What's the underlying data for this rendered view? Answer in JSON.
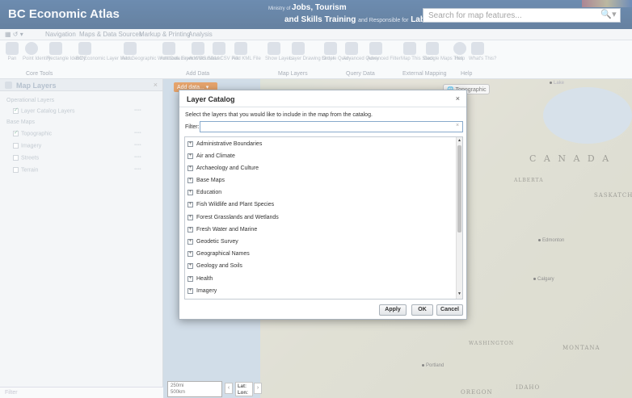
{
  "header": {
    "app_title": "BC Economic Atlas",
    "ministry_prefix": "Ministry of",
    "ministry_bold1": "Jobs, Tourism",
    "ministry_bold2": "and Skills Training",
    "ministry_suffix": "and Responsible for",
    "ministry_bold3": "Labour",
    "search_placeholder": "Search for map features..."
  },
  "menubar": {
    "items": [
      "Navigation",
      "Maps & Data Sources",
      "Markup & Printing",
      "Analysis"
    ]
  },
  "ribbon": {
    "buttons": [
      "Pan",
      "Point Identify",
      "Rectangle Identify",
      "BC Economic Layer Menu",
      "Add Geographic Workbook Layer",
      "Add Data From WMS Server",
      "Add Bounds",
      "Add CSV File",
      "Add KML File",
      "Show Layers",
      "Layer Drawing Order",
      "Simple Query",
      "Advanced Query",
      "Advanced Filter",
      "Map This Stack",
      "Google Maps This",
      "Help",
      "What's This?"
    ],
    "groups": [
      "Core Tools",
      "Add Data",
      "Map Layers",
      "Query Data",
      "External Mapping",
      "Help"
    ]
  },
  "left_panel": {
    "title": "Map Layers",
    "rows": [
      {
        "label": "Operational Layers",
        "checked": null
      },
      {
        "label": "Layer Catalog Layers",
        "checked": true
      },
      {
        "label": "Base Maps",
        "checked": null
      },
      {
        "label": "Topographic",
        "checked": true
      },
      {
        "label": "Imagery",
        "checked": false
      },
      {
        "label": "Streets",
        "checked": false
      },
      {
        "label": "Terrain",
        "checked": false
      }
    ],
    "filter_label": "Filter"
  },
  "map": {
    "add_data_label": "Add data...",
    "basemap_label": "Topographic",
    "country": "C A N A D A",
    "places": [
      "ALBERTA",
      "SASKATCH",
      "Edmonton",
      "Calgary",
      "MONTANA",
      "WASHINGTON",
      "IDAHO",
      "OREGON",
      "Portland",
      "Lake"
    ],
    "scale_1": "250mi",
    "scale_2": "500km",
    "lat_label": "Lat:",
    "lon_label": "Lon:"
  },
  "dialog": {
    "title": "Layer Catalog",
    "instruction": "Select the layers that you would like to include in the map from the catalog.",
    "filter_label": "Filter:",
    "filter_value": "",
    "categories": [
      "Administrative Boundaries",
      "Air and Climate",
      "Archaeology and Culture",
      "Base Maps",
      "Education",
      "Fish Wildlife and Plant Species",
      "Forest Grasslands and Wetlands",
      "Fresh Water and Marine",
      "Geodetic Survey",
      "Geographical Names",
      "Geology and Soils",
      "Health",
      "Imagery"
    ],
    "buttons": {
      "apply": "Apply",
      "ok": "OK",
      "cancel": "Cancel"
    }
  }
}
